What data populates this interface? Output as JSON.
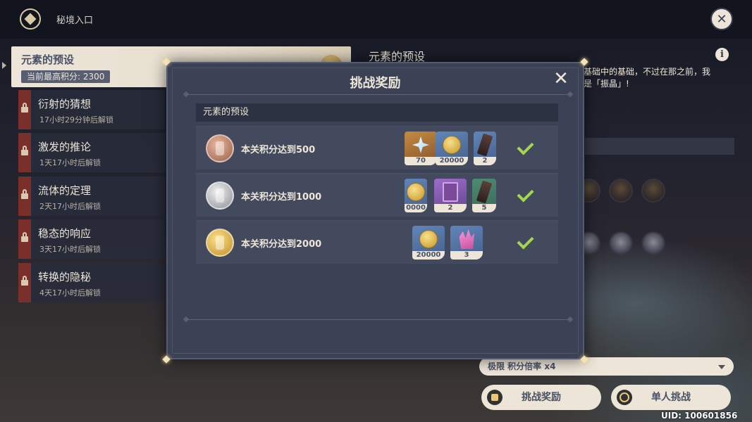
{
  "header": {
    "breadcrumb": "秘境入口",
    "icons": {
      "logo": "domain-diamond-icon",
      "close": "close-icon"
    }
  },
  "sidebar": {
    "active": {
      "title": "元素的预设",
      "subtitle": "当前最高积分: 2300"
    },
    "items": [
      {
        "title": "衍射的猜想",
        "subtitle": "17小时29分钟后解锁"
      },
      {
        "title": "激发的推论",
        "subtitle": "1天17小时后解锁"
      },
      {
        "title": "流体的定理",
        "subtitle": "2天17小时后解锁"
      },
      {
        "title": "稳态的响应",
        "subtitle": "3天17小时后解锁"
      },
      {
        "title": "转换的隐秘",
        "subtitle": "4天17小时后解锁"
      }
    ]
  },
  "right_panel": {
    "title": "元素的预设",
    "desc_line1": "基础中的基础，不过在那之前，我",
    "desc_line2": "是「振晶」!",
    "difficulty": "极限 积分倍率 x4",
    "reward_button": "挑战奖励",
    "solo_button": "单人挑战",
    "uid": "UID: 100601856"
  },
  "modal": {
    "title": "挑战奖励",
    "section": "元素的预设",
    "rows": [
      {
        "label": "本关积分达到500",
        "medal": "bronze",
        "rewards": [
          {
            "icon": "primogem-icon",
            "count": "70"
          },
          {
            "icon": "mora-icon",
            "count": "20000"
          },
          {
            "icon": "ore-icon",
            "count": "2"
          }
        ]
      },
      {
        "label": "本关积分达到1000",
        "medal": "silver",
        "rewards": [
          {
            "icon": "mora-icon",
            "count": "0000"
          },
          {
            "icon": "book-icon",
            "count": "2"
          },
          {
            "icon": "ore-icon",
            "count": "5"
          }
        ]
      },
      {
        "label": "本关积分达到2000",
        "medal": "gold",
        "rewards": [
          {
            "icon": "mora-icon",
            "count": "20000"
          },
          {
            "icon": "crystal-icon",
            "count": "3"
          }
        ]
      }
    ]
  },
  "colors": {
    "panel": "#3b4255",
    "cream": "#ece5d8",
    "check": "#a4d84a",
    "lock_bar": "#7a2f2a"
  }
}
